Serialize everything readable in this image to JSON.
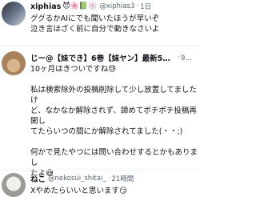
{
  "tweets": [
    {
      "name": "xiphias",
      "emojis": "😈🌸📗🍥",
      "handle": "@xiphias3",
      "time": "1日",
      "lines": [
        "ググるかAIにでも聞いたほうが早いぞ",
        "泣き言ほざく前に自分で動きなさいよ"
      ]
    },
    {
      "name": "じー@【妹でき】6巻【妹ヤン】最新5巻…",
      "emojis": "",
      "handle": "",
      "time": "9時間",
      "lines": [
        "10ヶ月はきついですね😓",
        "",
        "私は検索除外の投稿削除して少し放置してましたけ",
        "ど、なかなか解除されず、諦めてポチポチ投稿再開し",
        "てたらいつの間にか解除されてました(・・;)",
        "",
        "何かで見たやつには問い合わせするとかもありまし",
        "たよ😅"
      ]
    },
    {
      "name": "ねこ",
      "emojis": "",
      "handle": "@nekosui_shitai_",
      "time": "21時間",
      "lines": [
        "Xやめたらいいと思います😏"
      ]
    }
  ]
}
